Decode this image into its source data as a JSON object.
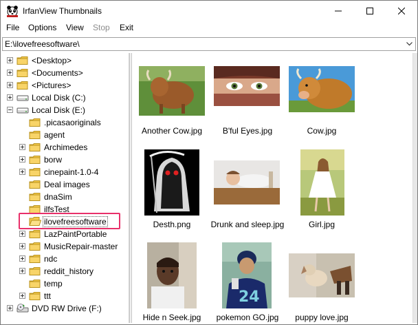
{
  "window": {
    "title": "IrfanView Thumbnails"
  },
  "menu": {
    "items": [
      "File",
      "Options",
      "View",
      "Stop",
      "Exit"
    ]
  },
  "path_bar": {
    "value": "E:\\ilovefreesoftware\\"
  },
  "tree": {
    "nodes": [
      {
        "label": "<Desktop>",
        "icon": "folder-icon",
        "expander": "plus"
      },
      {
        "label": "<Documents>",
        "icon": "folder-icon",
        "expander": "plus"
      },
      {
        "label": "<Pictures>",
        "icon": "folder-icon",
        "expander": "plus"
      },
      {
        "label": "Local Disk (C:)",
        "icon": "drive-icon",
        "expander": "plus"
      },
      {
        "label": "Local Disk (E:)",
        "icon": "drive-icon",
        "expander": "minus"
      },
      {
        "label": ".picasaoriginals",
        "icon": "folder-icon",
        "expander": "none"
      },
      {
        "label": "agent",
        "icon": "folder-icon",
        "expander": "none"
      },
      {
        "label": "Archimedes",
        "icon": "folder-icon",
        "expander": "plus"
      },
      {
        "label": "borw",
        "icon": "folder-icon",
        "expander": "plus"
      },
      {
        "label": "cinepaint-1.0-4",
        "icon": "folder-icon",
        "expander": "plus"
      },
      {
        "label": "Deal images",
        "icon": "folder-icon",
        "expander": "none"
      },
      {
        "label": "dnaSim",
        "icon": "folder-icon",
        "expander": "none"
      },
      {
        "label": "ilfsTest",
        "icon": "folder-icon",
        "expander": "none"
      },
      {
        "label": "ilovefreesoftware",
        "icon": "open-folder-icon",
        "expander": "none",
        "selected": true
      },
      {
        "label": "LazPaintPortable",
        "icon": "folder-icon",
        "expander": "plus"
      },
      {
        "label": "MusicRepair-master",
        "icon": "folder-icon",
        "expander": "plus"
      },
      {
        "label": "ndc",
        "icon": "folder-icon",
        "expander": "plus"
      },
      {
        "label": "reddit_history",
        "icon": "folder-icon",
        "expander": "plus"
      },
      {
        "label": "temp",
        "icon": "folder-icon",
        "expander": "none"
      },
      {
        "label": "ttt",
        "icon": "folder-icon",
        "expander": "plus"
      },
      {
        "label": "DVD RW Drive (F:)",
        "icon": "dvd-drive-icon",
        "expander": "plus"
      }
    ]
  },
  "thumbnails": [
    {
      "caption": "Another Cow.jpg"
    },
    {
      "caption": "B'ful Eyes.jpg"
    },
    {
      "caption": "Cow.jpg"
    },
    {
      "caption": "Desth.png"
    },
    {
      "caption": "Drunk and sleep.jpg"
    },
    {
      "caption": "Girl.jpg"
    },
    {
      "caption": "Hide n Seek.jpg"
    },
    {
      "caption": "pokemon GO.jpg"
    },
    {
      "caption": "puppy love.jpg"
    }
  ],
  "colors": {
    "highlight_box": "#e8306a",
    "folder": "#f5c94a",
    "splitter": "#f0f0f0"
  }
}
